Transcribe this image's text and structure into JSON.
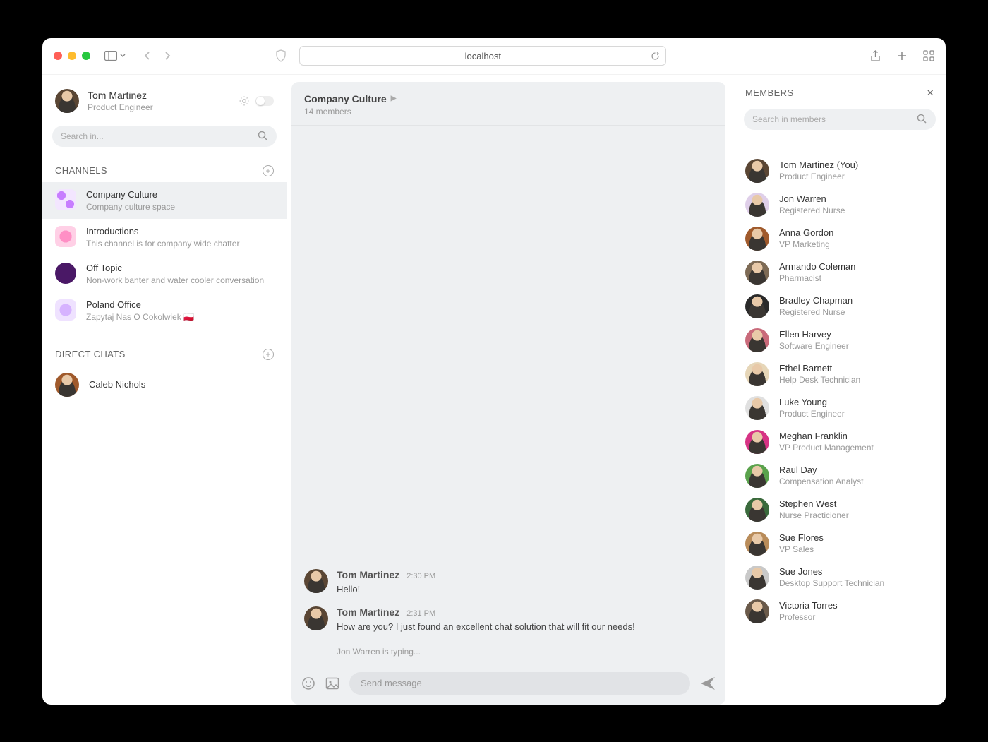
{
  "browser": {
    "url": "localhost"
  },
  "user": {
    "name": "Tom Martinez",
    "role": "Product Engineer"
  },
  "sidebar": {
    "search_placeholder": "Search in...",
    "channels_label": "CHANNELS",
    "direct_chats_label": "DIRECT CHATS",
    "channels": [
      {
        "name": "Company Culture",
        "desc": "Company culture space"
      },
      {
        "name": "Introductions",
        "desc": "This channel is for company wide chatter"
      },
      {
        "name": "Off Topic",
        "desc": "Non-work banter and water cooler conversation"
      },
      {
        "name": "Poland Office",
        "desc": "Zapytaj Nas O Cokolwiek 🇵🇱"
      }
    ],
    "direct_chats": [
      {
        "name": "Caleb Nichols"
      }
    ]
  },
  "channel_view": {
    "title": "Company Culture",
    "subtitle": "14 members",
    "messages": [
      {
        "author": "Tom Martinez",
        "time": "2:30 PM",
        "body": "Hello!"
      },
      {
        "author": "Tom Martinez",
        "time": "2:31 PM",
        "body": "How are you? I just found an excellent chat solution that will fit our needs!"
      }
    ],
    "typing": "Jon Warren is typing...",
    "composer_placeholder": "Send message"
  },
  "members_panel": {
    "title": "MEMBERS",
    "search_placeholder": "Search in members",
    "members": [
      {
        "name": "Tom Martinez (You)",
        "role": "Product Engineer",
        "online": true
      },
      {
        "name": "Jon Warren",
        "role": "Registered Nurse",
        "online": true
      },
      {
        "name": "Anna Gordon",
        "role": "VP Marketing",
        "online": false
      },
      {
        "name": "Armando Coleman",
        "role": "Pharmacist",
        "online": false
      },
      {
        "name": "Bradley Chapman",
        "role": "Registered Nurse",
        "online": false
      },
      {
        "name": "Ellen Harvey",
        "role": "Software Engineer",
        "online": false
      },
      {
        "name": "Ethel Barnett",
        "role": "Help Desk Technician",
        "online": false
      },
      {
        "name": "Luke Young",
        "role": "Product Engineer",
        "online": false
      },
      {
        "name": "Meghan Franklin",
        "role": "VP Product Management",
        "online": false
      },
      {
        "name": "Raul Day",
        "role": "Compensation Analyst",
        "online": false
      },
      {
        "name": "Stephen West",
        "role": "Nurse Practicioner",
        "online": false
      },
      {
        "name": "Sue Flores",
        "role": "VP Sales",
        "online": false
      },
      {
        "name": "Sue Jones",
        "role": "Desktop Support Technician",
        "online": false
      },
      {
        "name": "Victoria Torres",
        "role": "Professor",
        "online": false
      }
    ]
  }
}
